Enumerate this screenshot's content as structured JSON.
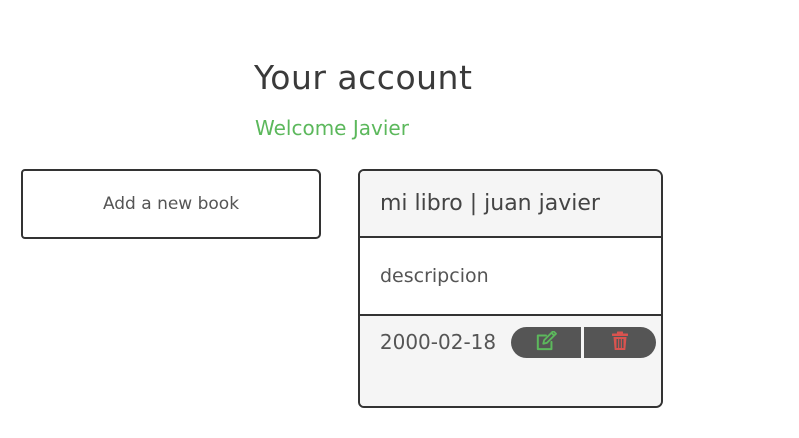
{
  "header": {
    "title": "Your account",
    "welcome": "Welcome Javier"
  },
  "actions": {
    "add_book_label": "Add a new book"
  },
  "book_card": {
    "title_line": "mi libro | juan javier",
    "description": "descripcion",
    "date": "2000-02-18",
    "edit_icon": "edit-icon",
    "delete_icon": "trash-icon"
  },
  "colors": {
    "welcome": "#5cb85c",
    "edit_icon": "#5cb85c",
    "delete_icon": "#d9534f",
    "button_bg": "#555555"
  }
}
